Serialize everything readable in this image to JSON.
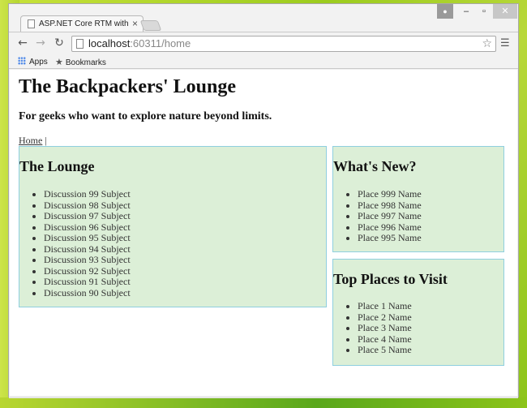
{
  "browser": {
    "tab_title": "ASP.NET Core RTM with A",
    "url_host": "localhost",
    "url_rest": ":60311/home",
    "bookmarks": [
      "Apps",
      "Bookmarks"
    ],
    "icons": {
      "back": "back-arrow-icon",
      "forward": "forward-arrow-icon",
      "reload": "reload-icon",
      "star": "star-icon",
      "menu": "hamburger-menu-icon"
    }
  },
  "page": {
    "title": "The Backpackers' Lounge",
    "subtitle": "For geeks who want to explore nature beyond limits.",
    "nav": {
      "home": "Home",
      "separator": "|"
    },
    "lounge": {
      "heading": "The Lounge",
      "items": [
        "Discussion 99 Subject",
        "Discussion 98 Subject",
        "Discussion 97 Subject",
        "Discussion 96 Subject",
        "Discussion 95 Subject",
        "Discussion 94 Subject",
        "Discussion 93 Subject",
        "Discussion 92 Subject",
        "Discussion 91 Subject",
        "Discussion 90 Subject"
      ]
    },
    "whats_new": {
      "heading": "What's New?",
      "items": [
        "Place 999 Name",
        "Place 998 Name",
        "Place 997 Name",
        "Place 996 Name",
        "Place 995 Name"
      ]
    },
    "top_places": {
      "heading": "Top Places to Visit",
      "items": [
        "Place 1 Name",
        "Place 2 Name",
        "Place 3 Name",
        "Place 4 Name",
        "Place 5 Name"
      ]
    }
  },
  "colors": {
    "panel_bg": "#dcefd7",
    "panel_border": "#8fcfdf"
  }
}
